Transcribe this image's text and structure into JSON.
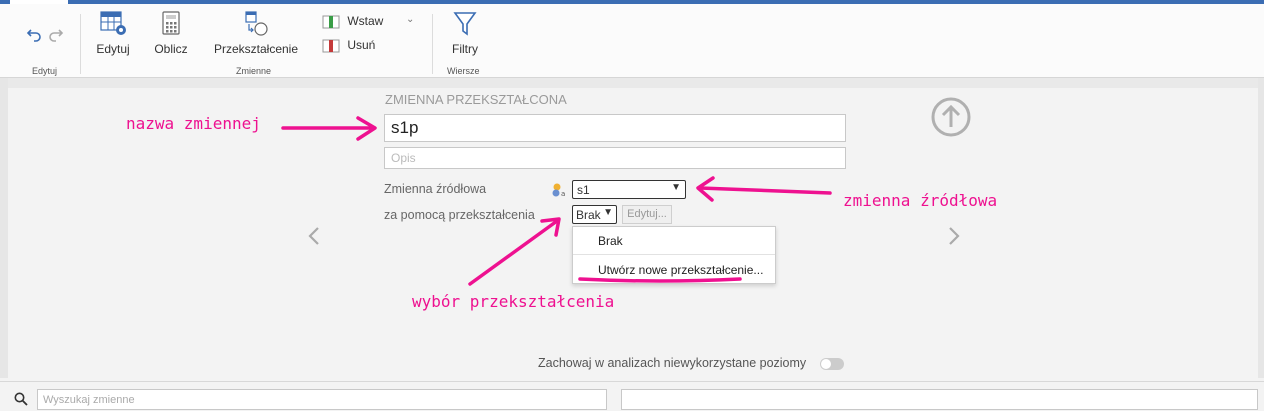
{
  "ribbon": {
    "edit_group_label": "Edytuj",
    "vars_group_label": "Zmienne",
    "rows_group_label": "Wiersze",
    "edit_button": "Edytuj",
    "compute_button": "Oblicz",
    "transform_button": "Przekształcenie",
    "insert_button": "Wstaw",
    "delete_button": "Usuń",
    "filters_button": "Filtry"
  },
  "form": {
    "section_title": "ZMIENNA PRZEKSZTAŁCONA",
    "name_value": "s1p",
    "desc_placeholder": "Opis",
    "source_label": "Zmienna źródłowa",
    "source_value": "s1",
    "transform_label": "za pomocą przekształcenia",
    "transform_value": "Brak",
    "edit_transform_button": "Edytuj...",
    "options": [
      "Brak",
      "Utwórz nowe przekształcenie..."
    ]
  },
  "annotations": {
    "name": "nazwa zmiennej",
    "source": "zmienna źródłowa",
    "transform": "wybór przekształcenia"
  },
  "footer": {
    "keep_levels_label": "Zachowaj w analizach niewykorzystane poziomy",
    "keep_levels_on": false,
    "search_placeholder": "Wyszukaj zmienne"
  },
  "colors": {
    "accent": "#3b6db3",
    "annotation": "#ee1190"
  }
}
